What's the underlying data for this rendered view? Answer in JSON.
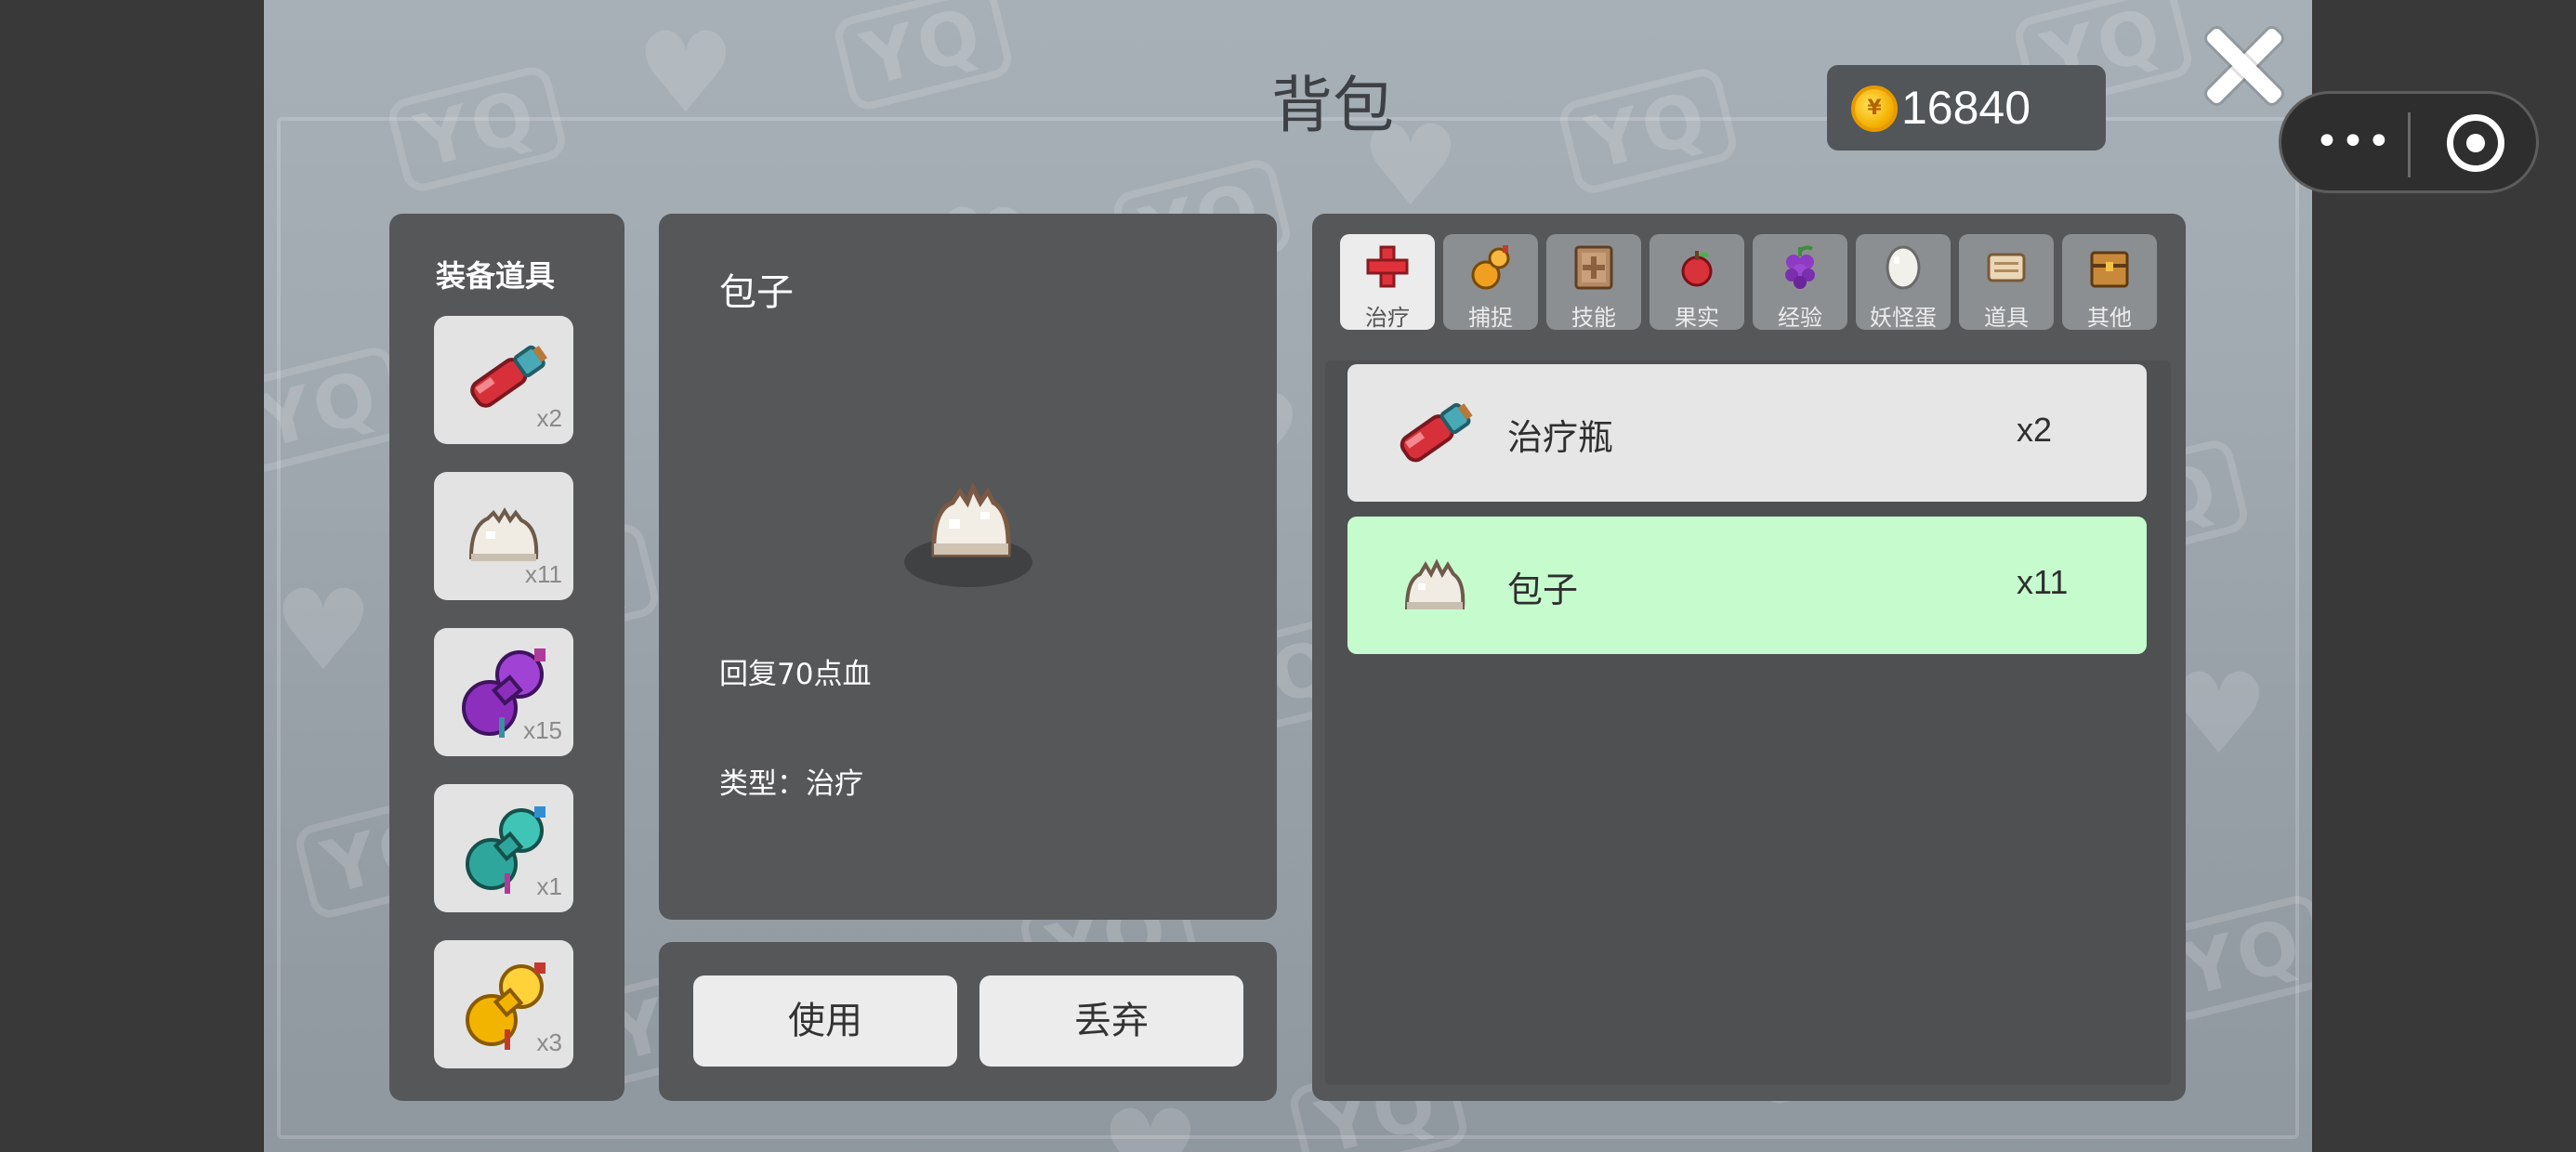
{
  "title": "背包",
  "currency": {
    "amount": "16840",
    "icon": "gold-coin-icon"
  },
  "watermark": "YQ",
  "equip": {
    "title": "装备道具",
    "slots": [
      {
        "icon": "healing-vial-icon",
        "qty": "x2"
      },
      {
        "icon": "steamed-bun-icon",
        "qty": "x11"
      },
      {
        "icon": "purple-gourd-icon",
        "qty": "x15"
      },
      {
        "icon": "teal-gourd-icon",
        "qty": "x1"
      },
      {
        "icon": "golden-gourd-icon",
        "qty": "x3"
      }
    ]
  },
  "detail": {
    "name": "包子",
    "icon": "steamed-bun-icon",
    "description": "回复70点血",
    "type_line": "类型：治疗"
  },
  "actions": {
    "use": "使用",
    "discard": "丢弃"
  },
  "tabs": [
    {
      "label": "治疗",
      "icon": "red-cross-icon",
      "active": true
    },
    {
      "label": "捕捉",
      "icon": "gourd-icon",
      "active": false
    },
    {
      "label": "技能",
      "icon": "skill-book-icon",
      "active": false
    },
    {
      "label": "果实",
      "icon": "apple-icon",
      "active": false
    },
    {
      "label": "经验",
      "icon": "grape-icon",
      "active": false
    },
    {
      "label": "妖怪蛋",
      "icon": "egg-icon",
      "active": false
    },
    {
      "label": "道具",
      "icon": "scroll-icon",
      "active": false
    },
    {
      "label": "其他",
      "icon": "chest-icon",
      "active": false
    }
  ],
  "items": [
    {
      "name": "治疗瓶",
      "qty": "x2",
      "icon": "healing-vial-icon",
      "selected": false
    },
    {
      "name": "包子",
      "qty": "x11",
      "icon": "steamed-bun-icon",
      "selected": true
    }
  ],
  "colors": {
    "selected_row": "#c6fbcd",
    "panel": "#555759",
    "tab_active": "#ececec"
  }
}
